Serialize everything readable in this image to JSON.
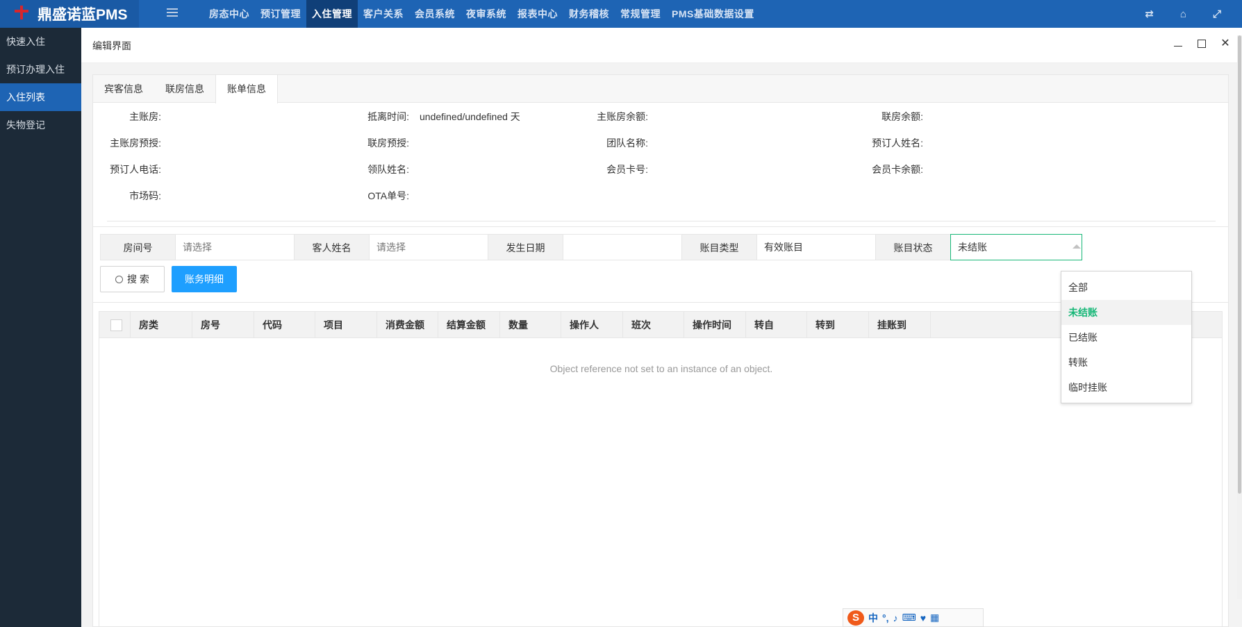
{
  "app": {
    "title": "鼎盛诺蓝PMS",
    "nav": [
      "房态中心",
      "预订管理",
      "入住管理",
      "客户关系",
      "会员系统",
      "夜审系统",
      "报表中心",
      "财务稽核",
      "常规管理",
      "PMS基础数据设置"
    ],
    "nav_active": "入住管理",
    "top_icons": [
      "swap-icon",
      "home-icon",
      "fullscreen-icon"
    ]
  },
  "sidebar": {
    "items": [
      "快速入住",
      "预订办理入住",
      "入住列表",
      "失物登记"
    ],
    "active": "入住列表"
  },
  "modal": {
    "title": "编辑界面",
    "tabs": [
      "宾客信息",
      "联房信息",
      "账单信息"
    ],
    "active_tab": "账单信息"
  },
  "info": {
    "main_room": {
      "label": "主账房:",
      "value": ""
    },
    "depart_time": {
      "label": "抵离时间:",
      "value": "undefined/undefined 天"
    },
    "main_balance": {
      "label": "主账房余额:",
      "value": ""
    },
    "linked_balance": {
      "label": "联房余额:",
      "value": ""
    },
    "main_preauth": {
      "label": "主账房预授:",
      "value": ""
    },
    "linked_preauth": {
      "label": "联房预授:",
      "value": ""
    },
    "team_name": {
      "label": "团队名称:",
      "value": ""
    },
    "booker_name": {
      "label": "预订人姓名:",
      "value": ""
    },
    "booker_phone": {
      "label": "预订人电话:",
      "value": ""
    },
    "leader_name": {
      "label": "领队姓名:",
      "value": ""
    },
    "member_card": {
      "label": "会员卡号:",
      "value": ""
    },
    "member_balance": {
      "label": "会员卡余额:",
      "value": ""
    },
    "market_code": {
      "label": "市场码:",
      "value": ""
    },
    "ota_no": {
      "label": "OTA单号:",
      "value": ""
    }
  },
  "filters": {
    "room_no": {
      "label": "房间号",
      "placeholder": "请选择"
    },
    "guest_name": {
      "label": "客人姓名",
      "placeholder": "请选择"
    },
    "date": {
      "label": "发生日期",
      "value": ""
    },
    "account_type": {
      "label": "账目类型",
      "value": "有效账目"
    },
    "account_status": {
      "label": "账目状态",
      "value": "未结账"
    },
    "search_button": "搜 索",
    "detail_button": "账务明细"
  },
  "table": {
    "columns": [
      "房类",
      "房号",
      "代码",
      "项目",
      "消费金额",
      "结算金额",
      "数量",
      "操作人",
      "班次",
      "操作时间",
      "转自",
      "转到",
      "挂账到"
    ],
    "empty_message": "Object reference not set to an instance of an object."
  },
  "status_dropdown": {
    "options": [
      "全部",
      "未结账",
      "已结账",
      "转账",
      "临时挂账"
    ],
    "selected": "未结账"
  },
  "ime": {
    "logo": "S",
    "mode": "中"
  },
  "colors": {
    "topbar": "#1e64b4",
    "sidebar": "#1c2a38",
    "accent_green": "#16b777",
    "primary_button": "#1e9fff"
  }
}
